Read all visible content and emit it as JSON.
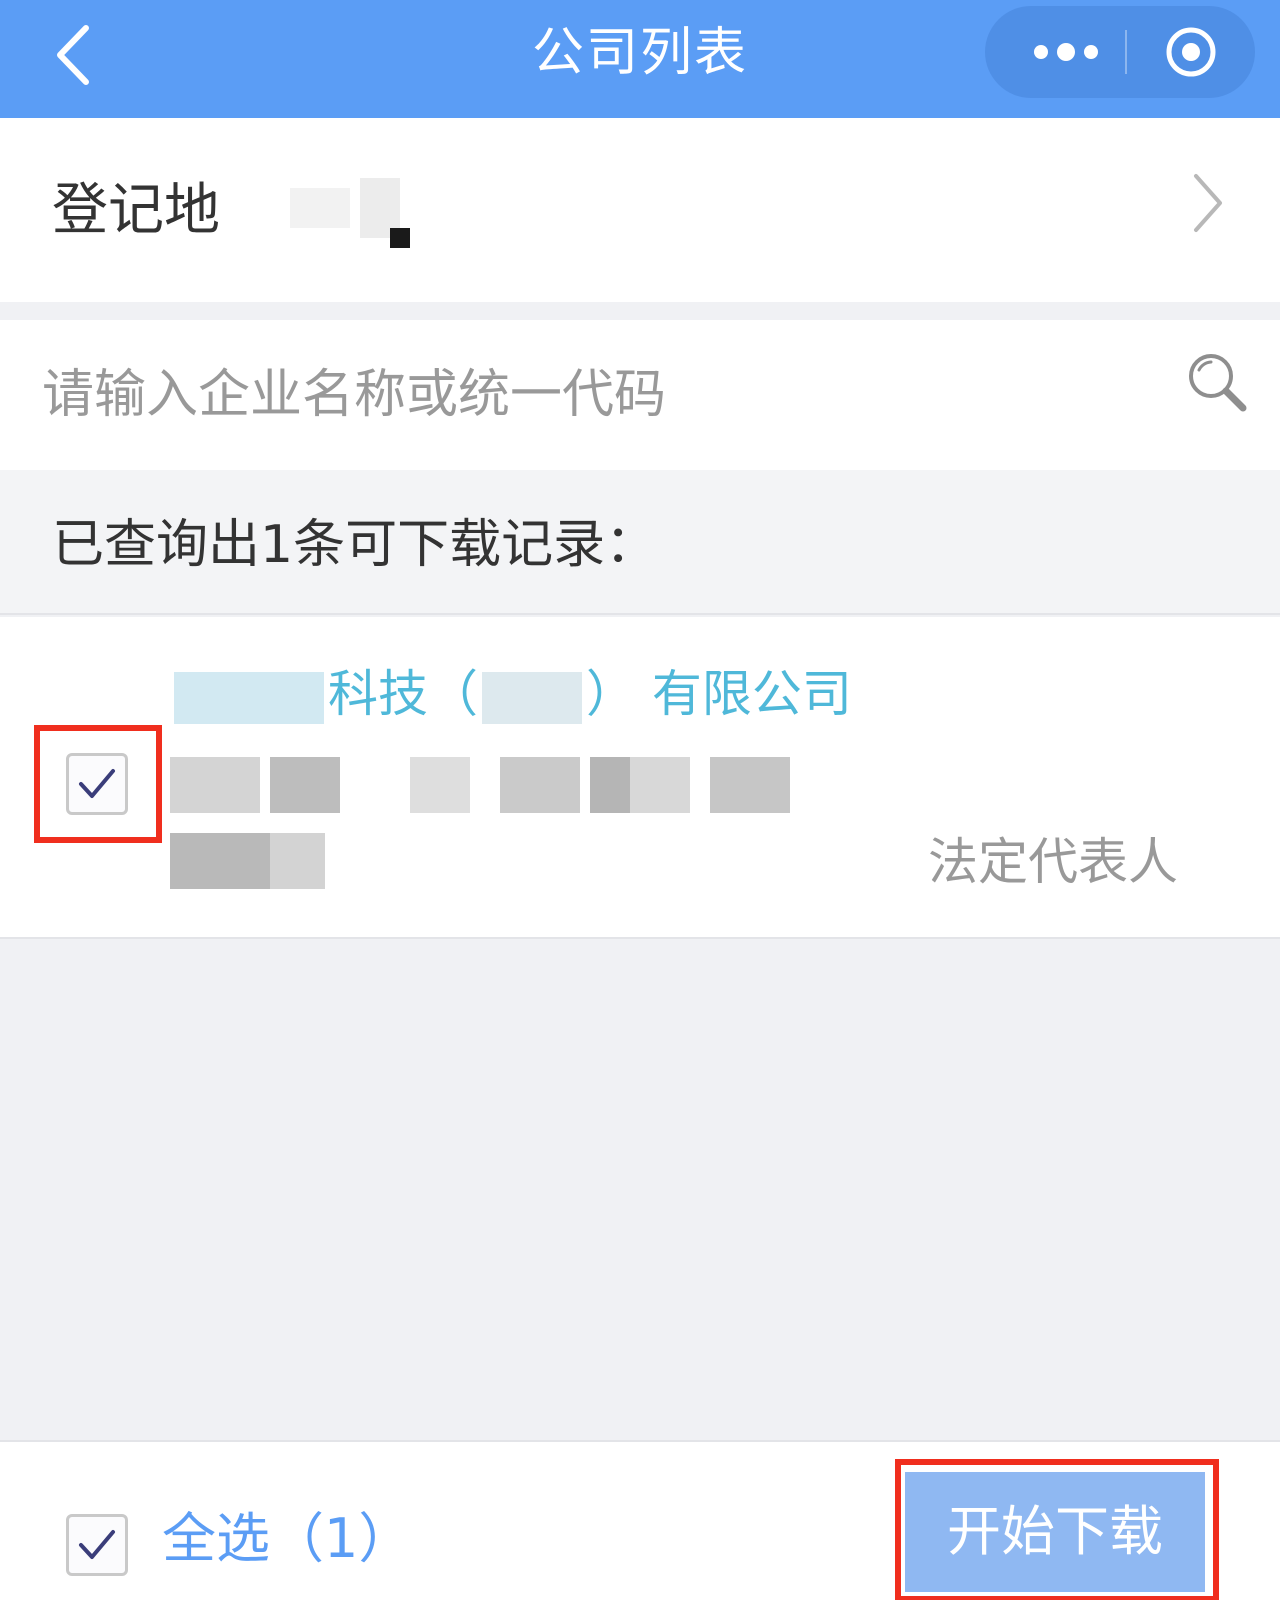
{
  "navbar": {
    "title": "公司列表",
    "back_icon": "chevron-left-icon",
    "more_icon": "more-dots-icon",
    "close_icon": "target-circle-icon",
    "bg_color": "#5b9df5"
  },
  "region": {
    "label": "登记地"
  },
  "search": {
    "placeholder": "请输入企业名称或统一代码"
  },
  "results": {
    "summary": "已查询出1条可下载记录："
  },
  "record": {
    "company_name_parts": [
      "科技",
      "（",
      "）",
      "有限公司"
    ],
    "legal_person_label": "法定代表人",
    "checked": true
  },
  "footer": {
    "select_all_label": "全选（1）",
    "download_label": "开始下载"
  }
}
